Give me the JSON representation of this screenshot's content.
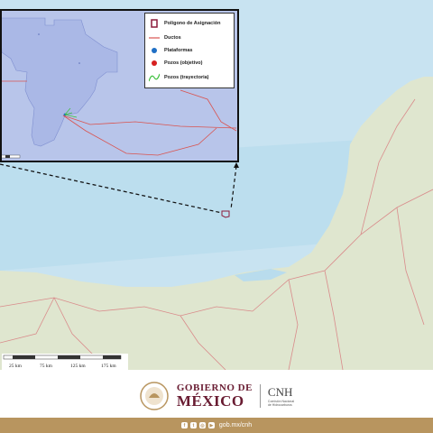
{
  "legend": {
    "items": [
      {
        "label": "Polígono de Asignación",
        "icon": "polygon-outline-icon",
        "color": "#8b1a3a"
      },
      {
        "label": "Ductos",
        "icon": "line-icon",
        "color": "#d9534f"
      },
      {
        "label": "Plataformas",
        "icon": "blue-dot-icon",
        "color": "#1f6fc5"
      },
      {
        "label": "Pozos (objetivo)",
        "icon": "red-dot-icon",
        "color": "#d62020"
      },
      {
        "label": "Pozos (trayectoria)",
        "icon": "green-curve-icon",
        "color": "#3bbf3b"
      }
    ]
  },
  "scale_bar": {
    "labels": [
      "25 km",
      "75 km",
      "125 km",
      "175 km"
    ]
  },
  "footer": {
    "gob_line1": "GOBIERNO DE",
    "gob_line2": "MÉXICO",
    "cnh_title": "CNH",
    "cnh_subtitle": [
      "Comisión Nacional",
      "de Hidrocarburos"
    ],
    "website": "gob.mx/cnh",
    "social_icons": [
      "facebook-icon",
      "twitter-icon",
      "instagram-icon",
      "youtube-icon"
    ]
  },
  "colors": {
    "sea_deep": "#c9e4f1",
    "sea_shallow": "#b4dbed",
    "land": "#dfe5cf",
    "roads": "#d98b8b",
    "inset_bg": "#b6c3e8",
    "polygon_fill": "#b0bfea",
    "brand": "#691c32",
    "bar": "#b8955f"
  }
}
